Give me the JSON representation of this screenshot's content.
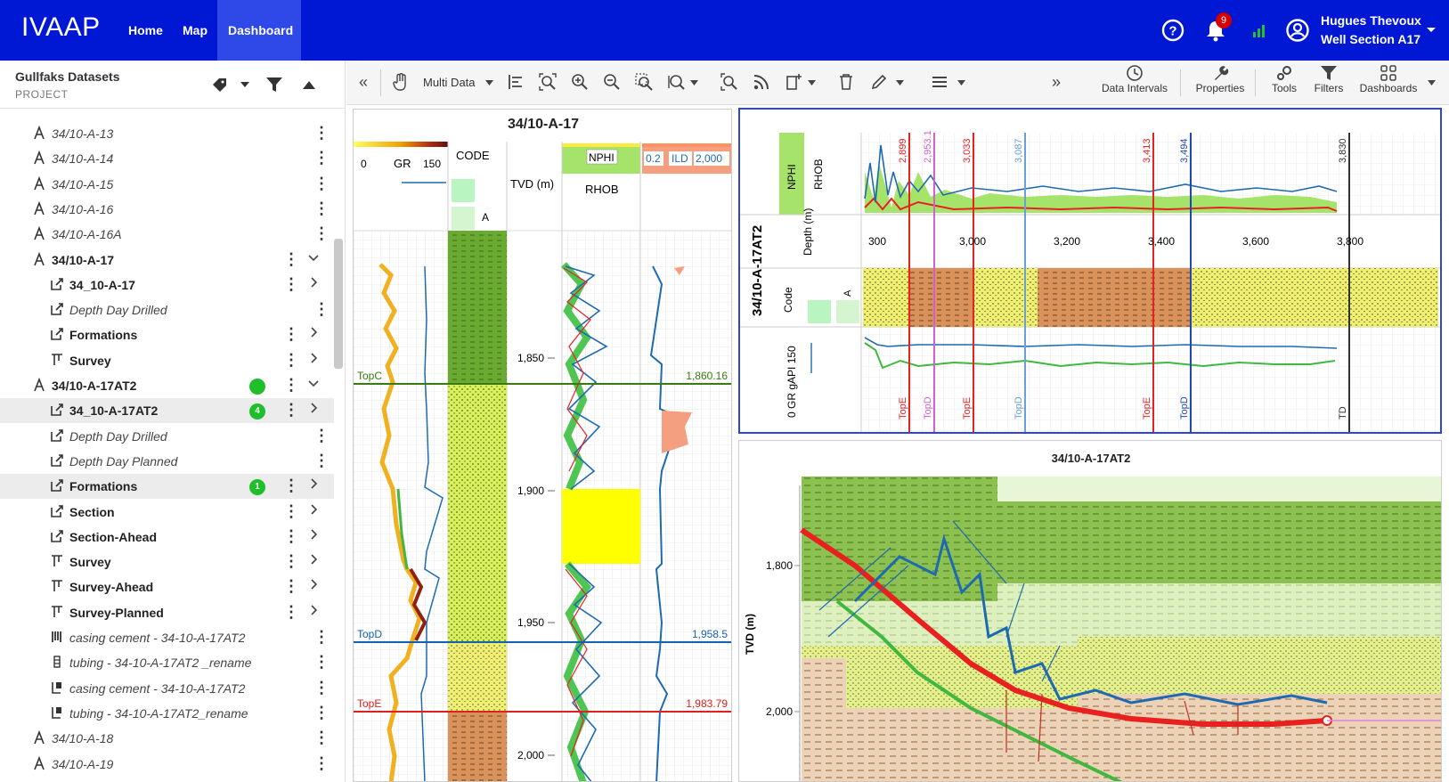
{
  "app": {
    "logo": "IVAAP"
  },
  "nav": {
    "home": "Home",
    "map": "Map",
    "dashboard": "Dashboard"
  },
  "user": {
    "name": "Hugues Thevoux",
    "context": "Well Section A17",
    "notifications": "9"
  },
  "left_panel": {
    "title": "Gullfaks Datasets",
    "subtitle": "PROJECT",
    "items": [
      {
        "label": "34/10-A-13",
        "style": "it",
        "indent": 0,
        "icon": "well-icon"
      },
      {
        "label": "34/10-A-14",
        "style": "it",
        "indent": 0,
        "icon": "well-icon"
      },
      {
        "label": "34/10-A-15",
        "style": "it",
        "indent": 0,
        "icon": "well-icon"
      },
      {
        "label": "34/10-A-16",
        "style": "it",
        "indent": 0,
        "icon": "well-icon"
      },
      {
        "label": "34/10-A-16A",
        "style": "it",
        "indent": 0,
        "icon": "well-icon"
      },
      {
        "label": "34/10-A-17",
        "style": "b",
        "indent": 0,
        "icon": "well-icon",
        "expand": "down"
      },
      {
        "label": "34_10-A-17",
        "style": "b",
        "indent": 1,
        "icon": "log-icon",
        "expand": "right"
      },
      {
        "label": "Depth Day Drilled",
        "style": "it",
        "indent": 1,
        "icon": "log-icon"
      },
      {
        "label": "Formations",
        "style": "b",
        "indent": 1,
        "icon": "log-icon",
        "expand": "right"
      },
      {
        "label": "Survey",
        "style": "b",
        "indent": 1,
        "icon": "survey-icon",
        "expand": "right"
      },
      {
        "label": "34/10-A-17AT2",
        "style": "b",
        "indent": 0,
        "icon": "well-icon",
        "expand": "down",
        "badge": " "
      },
      {
        "label": "34_10-A-17AT2",
        "style": "b",
        "indent": 1,
        "icon": "log-icon",
        "expand": "right",
        "badge": "4",
        "selected": true
      },
      {
        "label": "Depth Day Drilled",
        "style": "it",
        "indent": 1,
        "icon": "log-icon"
      },
      {
        "label": "Depth Day Planned",
        "style": "it",
        "indent": 1,
        "icon": "log-icon"
      },
      {
        "label": "Formations",
        "style": "b",
        "indent": 1,
        "icon": "log-icon",
        "expand": "right",
        "badge": "1",
        "selected": true
      },
      {
        "label": "Section",
        "style": "b",
        "indent": 1,
        "icon": "log-icon",
        "expand": "right"
      },
      {
        "label": "Section-Ahead",
        "style": "b",
        "indent": 1,
        "icon": "log-icon",
        "expand": "right"
      },
      {
        "label": "Survey",
        "style": "b",
        "indent": 1,
        "icon": "survey-icon",
        "expand": "right"
      },
      {
        "label": "Survey-Ahead",
        "style": "b",
        "indent": 1,
        "icon": "survey-icon",
        "expand": "right"
      },
      {
        "label": "Survey-Planned",
        "style": "b",
        "indent": 1,
        "icon": "survey-icon",
        "expand": "right"
      },
      {
        "label": "casing cement - 34-10-A-17AT2",
        "style": "it",
        "indent": 1,
        "icon": "casing-icon"
      },
      {
        "label": "tubing - 34-10-A-17AT2 _rename",
        "style": "it",
        "indent": 1,
        "icon": "tubing-icon"
      },
      {
        "label": "casing cement - 34-10-A-17AT2",
        "style": "it",
        "indent": 1,
        "icon": "casing2-icon"
      },
      {
        "label": "tubing - 34-10-A-17AT2_rename",
        "style": "it",
        "indent": 1,
        "icon": "casing2-icon"
      },
      {
        "label": "34/10-A-18",
        "style": "it",
        "indent": 0,
        "icon": "well-icon"
      },
      {
        "label": "34/10-A-19",
        "style": "it",
        "indent": 0,
        "icon": "well-icon"
      }
    ]
  },
  "toolbar": {
    "multi_data": "Multi Data",
    "data_intervals": "Data Intervals",
    "properties": "Properties",
    "tools": "Tools",
    "filters": "Filters",
    "dashboards": "Dashboards"
  },
  "log_view": {
    "title": "34/10-A-17",
    "gr_min": "0",
    "gr_label": "GR",
    "gr_max": "150",
    "code_label": "CODE",
    "code_a": "A",
    "depth_label": "TVD (m)",
    "nphi_label": "NPHI",
    "rhob_label": "RHOB",
    "ild_min": "0.2",
    "ild_label": "ILD",
    "ild_max": "2,000",
    "depths": [
      "1,850",
      "1,900",
      "1,950",
      "2,000"
    ],
    "tops": [
      {
        "name": "TopC",
        "value": "1,860.16",
        "color": "#3a7a10"
      },
      {
        "name": "TopD",
        "value": "1,958.5",
        "color": "#1560b0"
      },
      {
        "name": "TopE",
        "value": "1,983.79",
        "color": "#e02020"
      }
    ]
  },
  "section_view": {
    "well": "34/10-A-17AT2",
    "nphi": "NPHI",
    "rhob": "RHOB",
    "depth_label": "Depth (m)",
    "code_label": "Code",
    "code_a": "A",
    "gr_label": "0  GR  gAPI  150",
    "depth_ticks": [
      "300",
      "3,000",
      "3,200",
      "3,400",
      "3,600",
      "3,800"
    ],
    "markers_top": [
      "2,899",
      "2,953.1",
      "3,033",
      "3,087",
      "3,413",
      "3,494",
      "3,830"
    ],
    "markers_bottom": [
      "TopE",
      "TopD",
      "TopE",
      "TopD",
      "TopE",
      "TopD",
      "TD"
    ]
  },
  "cross_section": {
    "title": "34/10-A-17AT2",
    "ylabel": "TVD (m)",
    "yticks": [
      "1,800",
      "2,000"
    ]
  },
  "colors": {
    "nav": "#0017d4",
    "accent_blue": "#2f44d8",
    "badge_green": "#1fbf2c",
    "badge_red": "#d40000"
  }
}
